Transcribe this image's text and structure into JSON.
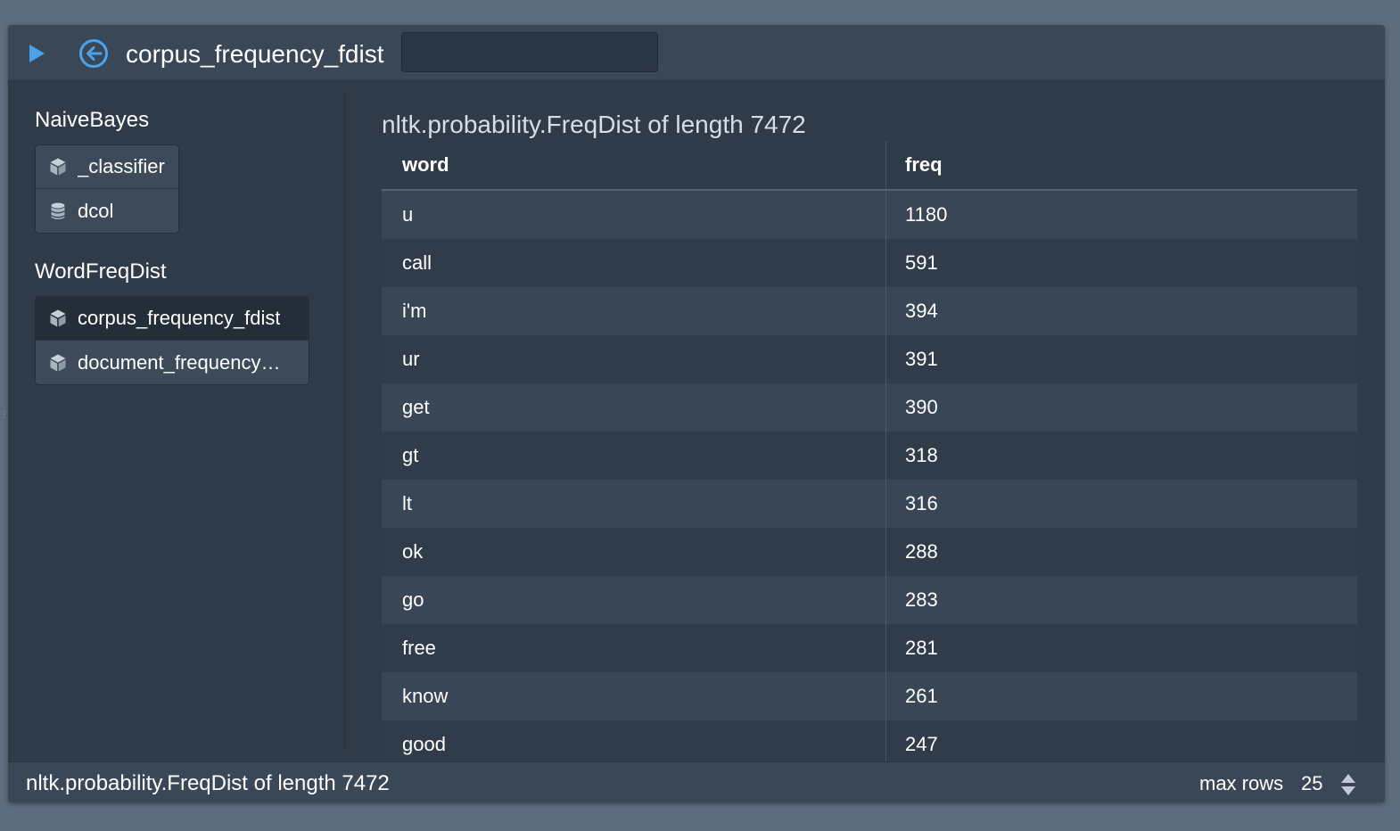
{
  "toolbar": {
    "title": "corpus_frequency_fdist",
    "search_value": ""
  },
  "sidebar": {
    "groups": [
      {
        "title": "NaiveBayes",
        "items": [
          {
            "label": "_classifier",
            "icon": "cube-icon"
          },
          {
            "label": "dcol",
            "icon": "database-icon"
          }
        ]
      },
      {
        "title": "WordFreqDist",
        "items": [
          {
            "label": "corpus_frequency_fdist",
            "icon": "cube-icon",
            "selected": true
          },
          {
            "label": "document_frequency…",
            "icon": "cube-icon"
          }
        ]
      }
    ]
  },
  "main": {
    "heading": "nltk.probability.FreqDist of length 7472",
    "columns": [
      "word",
      "freq"
    ],
    "rows": [
      {
        "word": "u",
        "freq": "1180"
      },
      {
        "word": "call",
        "freq": "591"
      },
      {
        "word": "i'm",
        "freq": "394"
      },
      {
        "word": "ur",
        "freq": "391"
      },
      {
        "word": "get",
        "freq": "390"
      },
      {
        "word": "gt",
        "freq": "318"
      },
      {
        "word": "lt",
        "freq": "316"
      },
      {
        "word": "ok",
        "freq": "288"
      },
      {
        "word": "go",
        "freq": "283"
      },
      {
        "word": "free",
        "freq": "281"
      },
      {
        "word": "know",
        "freq": "261"
      },
      {
        "word": "good",
        "freq": "247"
      }
    ]
  },
  "statusbar": {
    "text": "nltk.probability.FreqDist of length 7472",
    "max_rows_label": "max rows",
    "max_rows_value": "25"
  },
  "colors": {
    "accent": "#4da3ea",
    "background": "#2f3b48",
    "toolbar": "#3a4756"
  }
}
